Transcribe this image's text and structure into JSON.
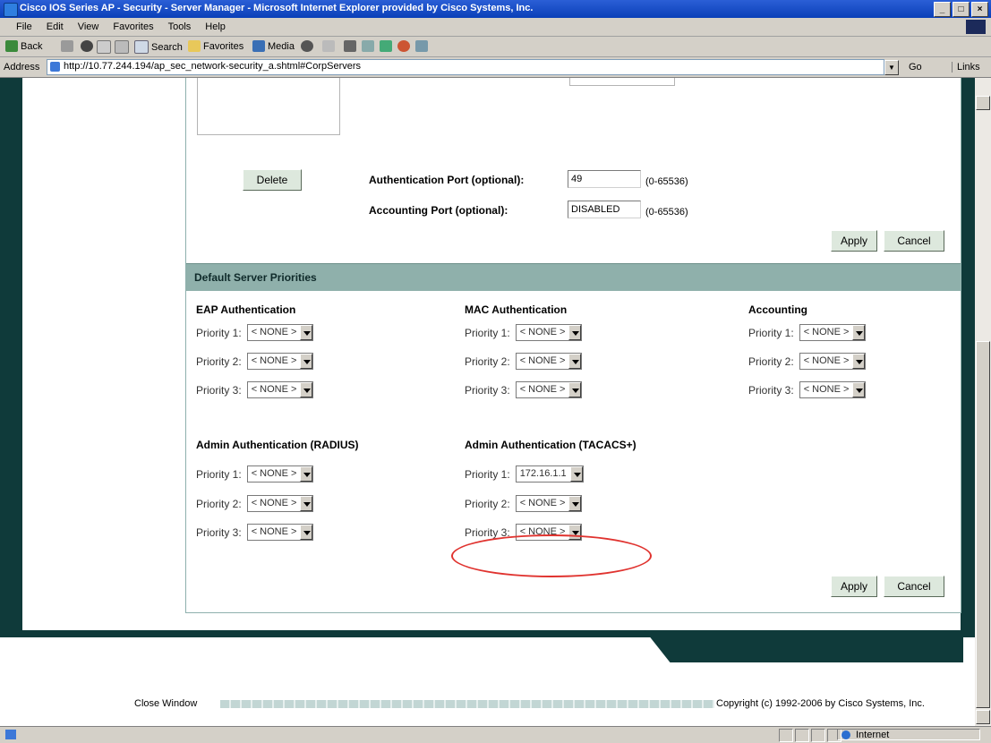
{
  "window": {
    "title": "Cisco IOS Series AP - Security - Server Manager - Microsoft Internet Explorer provided by Cisco Systems, Inc.",
    "controls": [
      "_",
      "□",
      "×"
    ]
  },
  "menubar": [
    "File",
    "Edit",
    "View",
    "Favorites",
    "Tools",
    "Help"
  ],
  "toolbar": {
    "back": "Back",
    "search": "Search",
    "favorites": "Favorites",
    "media": "Media"
  },
  "addressbar": {
    "label": "Address",
    "url": "http://10.77.244.194/ap_sec_network-security_a.shtml#CorpServers",
    "go": "Go",
    "links": "Links"
  },
  "top_form": {
    "delete_label": "Delete",
    "auth_port_label": "Authentication Port (optional):",
    "auth_port_value": "49",
    "auth_port_range": "(0-65536)",
    "acct_port_label": "Accounting Port (optional):",
    "acct_port_value": "DISABLED",
    "acct_port_range": "(0-65536)",
    "apply_label": "Apply",
    "cancel_label": "Cancel"
  },
  "priorities": {
    "section_title": "Default Server Priorities",
    "eap": {
      "heading": "EAP Authentication",
      "rows": [
        {
          "label": "Priority 1:",
          "value": "< NONE >"
        },
        {
          "label": "Priority 2:",
          "value": "< NONE >"
        },
        {
          "label": "Priority 3:",
          "value": "< NONE >"
        }
      ]
    },
    "mac": {
      "heading": "MAC Authentication",
      "rows": [
        {
          "label": "Priority 1:",
          "value": "< NONE >"
        },
        {
          "label": "Priority 2:",
          "value": "< NONE >"
        },
        {
          "label": "Priority 3:",
          "value": "< NONE >"
        }
      ]
    },
    "accounting": {
      "heading": "Accounting",
      "rows": [
        {
          "label": "Priority 1:",
          "value": "< NONE >"
        },
        {
          "label": "Priority 2:",
          "value": "< NONE >"
        },
        {
          "label": "Priority 3:",
          "value": "< NONE >"
        }
      ]
    },
    "admin_radius": {
      "heading": "Admin Authentication (RADIUS)",
      "rows": [
        {
          "label": "Priority 1:",
          "value": "< NONE >"
        },
        {
          "label": "Priority 2:",
          "value": "< NONE >"
        },
        {
          "label": "Priority 3:",
          "value": "< NONE >"
        }
      ]
    },
    "admin_tacacs": {
      "heading": "Admin Authentication (TACACS+)",
      "rows": [
        {
          "label": "Priority 1:",
          "value": "172.16.1.1"
        },
        {
          "label": "Priority 2:",
          "value": "< NONE >"
        },
        {
          "label": "Priority 3:",
          "value": "< NONE >"
        }
      ]
    },
    "apply_label": "Apply",
    "cancel_label": "Cancel"
  },
  "footer": {
    "close_window": "Close Window",
    "copyright": "Copyright (c) 1992-2006 by Cisco Systems, Inc."
  },
  "statusbar": {
    "zone": "Internet"
  },
  "colors": {
    "teal_dark": "#0f3a3a",
    "section_bar": "#8fb0ab",
    "highlight_ring": "#e0332f"
  }
}
